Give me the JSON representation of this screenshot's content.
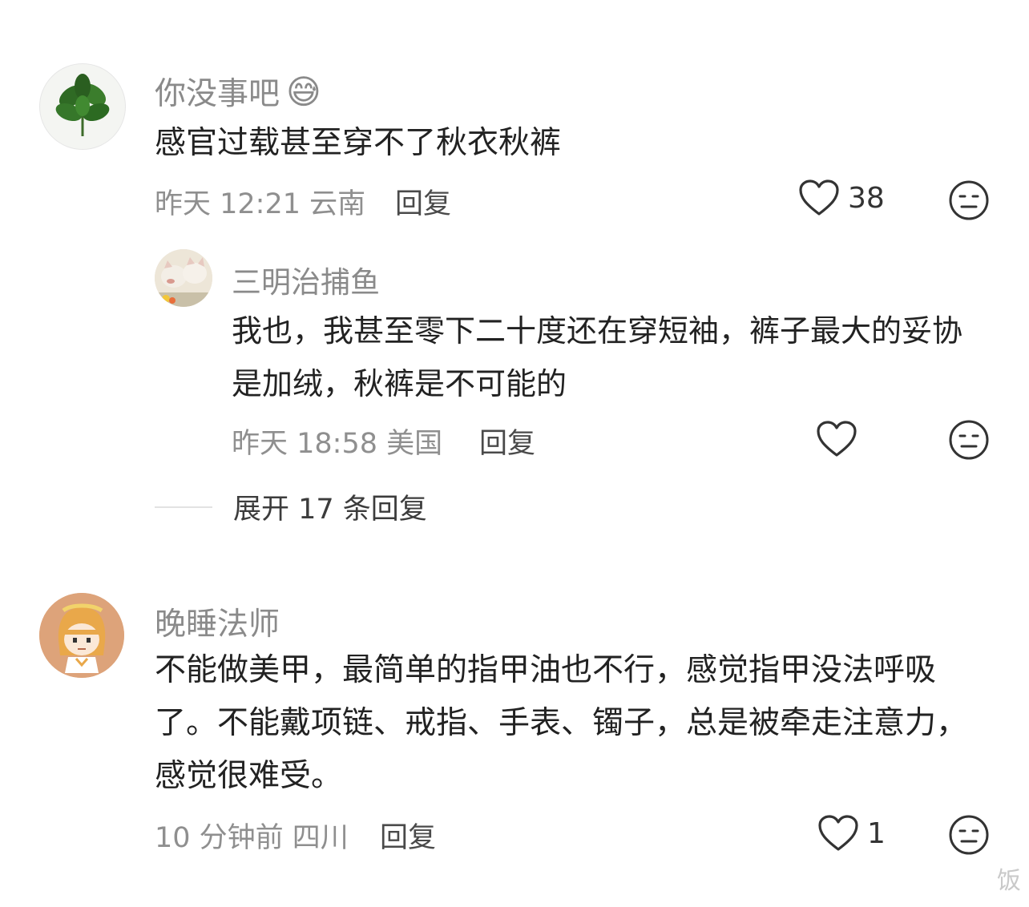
{
  "comments": [
    {
      "author": "你没事吧",
      "emoji": "😅",
      "text": "感官过载甚至穿不了秋衣秋裤",
      "meta": "昨天 12:21 云南",
      "reply_label": "回复",
      "likes": "38",
      "avatar_icon": "plant-leaves-avatar",
      "replies": [
        {
          "author": "三明治捕鱼",
          "text": "我也，我甚至零下二十度还在穿短袖，裤子最大的妥协是加绒，秋裤是不可能的",
          "meta": "昨天 18:58 美国",
          "reply_label": "回复",
          "likes": "",
          "avatar_icon": "cats-photo-avatar"
        }
      ],
      "expand_label": "展开 17 条回复"
    },
    {
      "author": "晚睡法师",
      "text": "不能做美甲，最简单的指甲油也不行，感觉指甲没法呼吸了。不能戴项链、戒指、手表、镯子，总是被牵走注意力，感觉很难受。",
      "meta": "10 分钟前 四川",
      "reply_label": "回复",
      "likes": "1",
      "avatar_icon": "cartoon-girl-avatar"
    }
  ],
  "watermark": "饭",
  "colors": {
    "name": "#8a8a8a",
    "meta": "#8f8f8f",
    "body": "#222222"
  }
}
